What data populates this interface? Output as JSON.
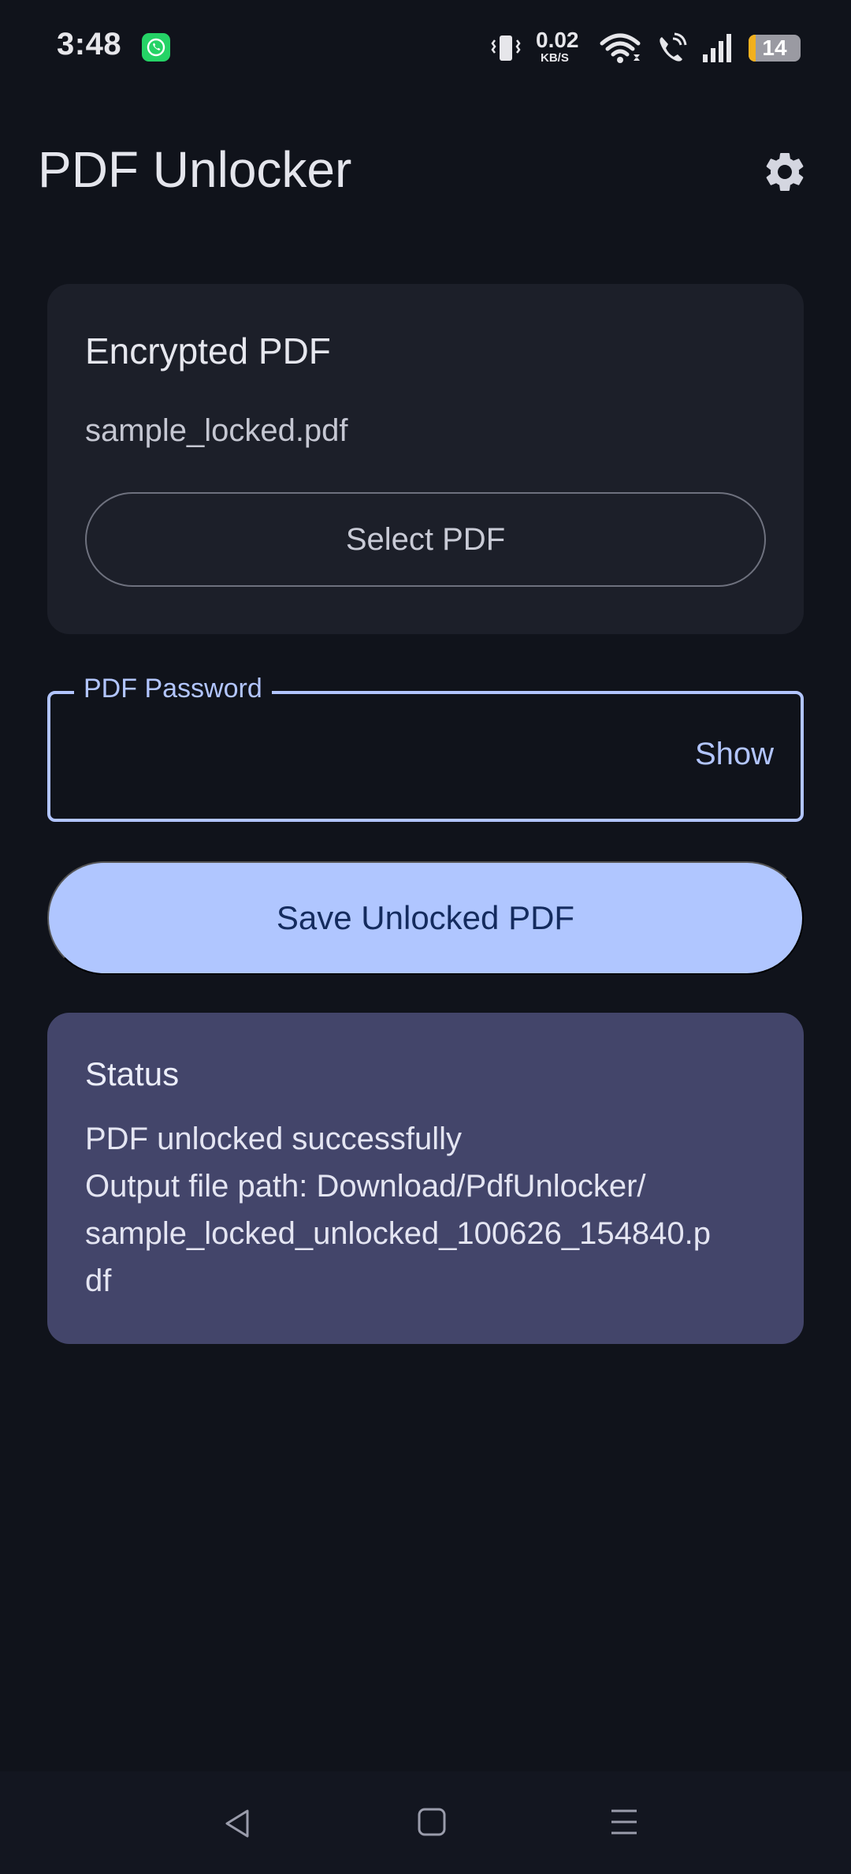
{
  "status_bar": {
    "time": "3:48",
    "net_speed_value": "0.02",
    "net_speed_unit": "KB/S",
    "battery_level": "14",
    "battery_fraction": 0.14,
    "icons": [
      "whatsapp-icon",
      "vibrate-icon",
      "wifi-icon",
      "wifi-call-icon",
      "signal-icon",
      "battery-icon"
    ]
  },
  "app_bar": {
    "title": "PDF Unlocker",
    "settings_icon": "gear-icon"
  },
  "encrypted_card": {
    "title": "Encrypted PDF",
    "file_name": "sample_locked.pdf",
    "select_button": "Select PDF"
  },
  "password_field": {
    "label": "PDF Password",
    "value": "",
    "toggle_label": "Show"
  },
  "save_button": "Save Unlocked PDF",
  "status_card": {
    "title": "Status",
    "lines": [
      "PDF unlocked successfully",
      "Output file path: Download/PdfUnlocker/",
      "sample_locked_unlocked_100626_154840.p",
      "df"
    ]
  },
  "nav_bar": {
    "icons": [
      "back-icon",
      "home-icon",
      "recents-icon"
    ]
  },
  "colors": {
    "background": "#10131b",
    "card": "#1c1f29",
    "accent": "#b0c6ff",
    "status_card": "#43456a",
    "battery_fill": "#f2b01e"
  }
}
